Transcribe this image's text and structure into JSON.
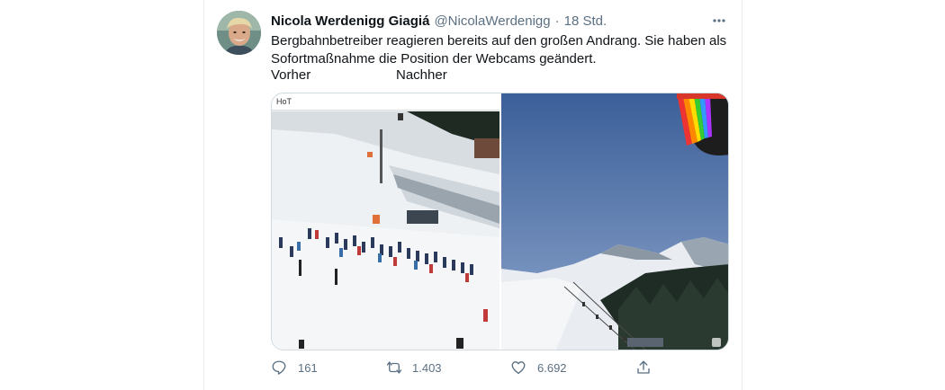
{
  "tweet": {
    "author_name": "Nicola Werdenigg Giagiá",
    "author_handle": "@NicolaWerdenigg",
    "separator": "·",
    "time": "18 Std.",
    "more_icon": "more-horizontal-icon",
    "text_line_1": "Bergbahnbetreiber reagieren bereits auf den großen Andrang. Sie haben als",
    "text_line_2": "Sofortmaßnahme die Position der Webcams geändert.",
    "label_before": "Vorher",
    "label_after": "Nachher"
  },
  "media": {
    "left_watermark": "HoT",
    "left_description": "ski-lift-crowd-photo",
    "right_description": "mountain-webcam-photo"
  },
  "actions": {
    "reply_count": "161",
    "retweet_count": "1.403",
    "like_count": "6.692",
    "reply_icon": "reply-icon",
    "retweet_icon": "retweet-icon",
    "like_icon": "heart-icon",
    "share_icon": "share-icon"
  },
  "colors": {
    "secondary_text": "#5b7083",
    "border": "#e6ecf0",
    "sky": "#5f7fb3"
  }
}
